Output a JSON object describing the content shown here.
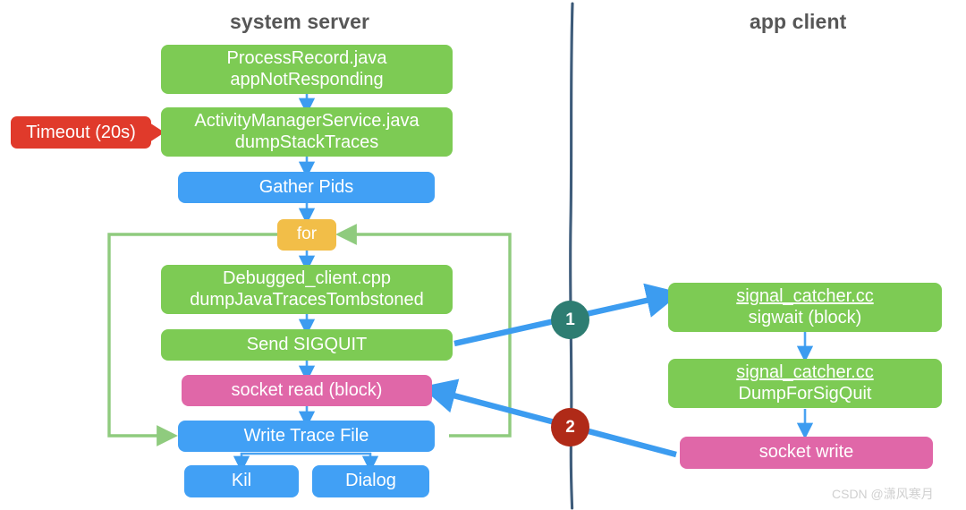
{
  "lanes": [
    {
      "title": "system server"
    },
    {
      "title": "app client"
    }
  ],
  "colors": {
    "green": "#7DCB54",
    "blue": "#41A0F5",
    "pink": "#E067A8",
    "orange": "#F2BE48",
    "red": "#E03A2B",
    "arrow_blue": "#3C9CF0",
    "loop_green": "#8FCB7E",
    "divider": "#2B4A6B",
    "circle_1": "#2E7D72",
    "circle_2": "#B02A18",
    "title_text": "#575757",
    "node_text": "#FFFFFF",
    "watermark": "#D0D0D0"
  },
  "server_nodes": {
    "process_record": {
      "line1": "ProcessRecord.java",
      "line2": "appNotResponding"
    },
    "activity_manager": {
      "line1": "ActivityManagerService.java",
      "line2": "dumpStackTraces"
    },
    "gather_pids": {
      "line1": "Gather Pids"
    },
    "for_loop": {
      "line1": "for"
    },
    "debugged_client": {
      "line1": "Debugged_client.cpp",
      "line2": "dumpJavaTracesTombstoned"
    },
    "send_sigquit": {
      "line1": "Send SIGQUIT"
    },
    "socket_read": {
      "line1": "socket read  (block)"
    },
    "write_trace_file": {
      "line1": "Write Trace File"
    },
    "kill": {
      "line1": "Kil"
    },
    "dialog": {
      "line1": "Dialog"
    }
  },
  "client_nodes": {
    "sigwait": {
      "line1": "signal_catcher.cc",
      "line2": "sigwait  (block)"
    },
    "dump_for_sigquit": {
      "line1": "signal_catcher.cc",
      "line2": "DumpForSigQuit"
    },
    "socket_write": {
      "line1": "socket write"
    }
  },
  "annotations": {
    "timeout": "Timeout (20s)",
    "step_one": "1",
    "step_two": "2"
  },
  "watermark": "CSDN @潇风寒月"
}
